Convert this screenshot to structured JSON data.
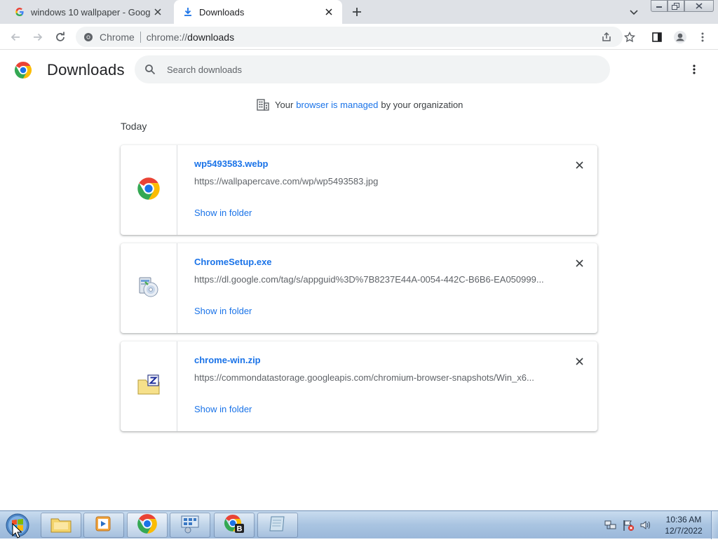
{
  "tabs": [
    {
      "title": "windows 10 wallpaper - Google S",
      "icon": "google-g-icon",
      "active": false
    },
    {
      "title": "Downloads",
      "icon": "download-icon",
      "active": true
    }
  ],
  "toolbar": {
    "omnibox_chip": "Chrome",
    "url_scheme": "chrome://",
    "url_host": "downloads"
  },
  "page": {
    "title": "Downloads",
    "search_placeholder": "Search downloads",
    "managed_prefix": "Your",
    "managed_link": "browser is managed",
    "managed_suffix": "by your organization",
    "section_date": "Today"
  },
  "downloads": [
    {
      "file_name": "wp5493583.webp",
      "url": "https://wallpapercave.com/wp/wp5493583.jpg",
      "action": "Show in folder",
      "icon": "chrome-file-icon"
    },
    {
      "file_name": "ChromeSetup.exe",
      "url": "https://dl.google.com/tag/s/appguid%3D%7B8237E44A-0054-442C-B6B6-EA050999...",
      "action": "Show in folder",
      "icon": "installer-icon"
    },
    {
      "file_name": "chrome-win.zip",
      "url": "https://commondatastorage.googleapis.com/chromium-browser-snapshots/Win_x6...",
      "action": "Show in folder",
      "icon": "zip-folder-icon"
    }
  ],
  "taskbar": {
    "time": "10:36 AM",
    "date": "12/7/2022"
  },
  "colors": {
    "accent": "#1a73e8",
    "tabstrip": "#dee1e6",
    "omnibox": "#f1f3f4"
  }
}
